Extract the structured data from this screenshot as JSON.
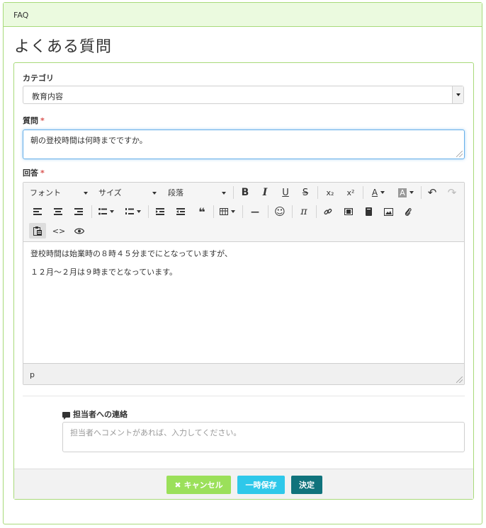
{
  "header": {
    "title": "FAQ"
  },
  "page_title": "よくある質問",
  "form": {
    "category": {
      "label": "カテゴリ",
      "value": "教育内容"
    },
    "question": {
      "label": "質問",
      "required_mark": "*",
      "value": "朝の登校時間は何時までですか。"
    },
    "answer": {
      "label": "回答",
      "required_mark": "*",
      "toolbar": {
        "font_label": "フォント",
        "size_label": "サイズ",
        "paragraph_label": "段落",
        "icons": [
          "bold-icon",
          "italic-icon",
          "underline-icon",
          "strikethrough-icon",
          "subscript-icon",
          "superscript-icon",
          "text-color-icon",
          "background-color-icon",
          "undo-icon",
          "redo-icon",
          "align-left-icon",
          "align-center-icon",
          "align-right-icon",
          "bullet-list-icon",
          "numbered-list-icon",
          "indent-icon",
          "outdent-icon",
          "blockquote-icon",
          "table-icon",
          "horizontal-rule-icon",
          "emoji-icon",
          "math-icon",
          "link-icon",
          "video-icon",
          "document-icon",
          "image-icon",
          "attachment-icon",
          "paste-text-icon",
          "source-code-icon",
          "preview-icon"
        ],
        "glyphs": {
          "bold": "B",
          "italic": "I",
          "underline": "U",
          "strike": "S",
          "sub": "x₂",
          "sup": "x²",
          "text_color": "A",
          "bg_color": "A",
          "undo": "↶",
          "redo": "↷",
          "quote": "❝",
          "hr": "—",
          "emoji": "☺",
          "pi": "π",
          "code": "<>",
          "link": "🔗"
        }
      },
      "content": [
        "登校時間は始業時の８時４５分までにとなっていますが、",
        "１２月〜２月は９時までとなっています。"
      ],
      "status_path": "p"
    },
    "contact": {
      "label": "担当者への連絡",
      "placeholder": "担当者へコメントがあれば、入力してください。"
    }
  },
  "buttons": {
    "cancel": "キャンセル",
    "cancel_icon": "✖",
    "temp_save": "一時保存",
    "confirm": "決定"
  },
  "colors": {
    "green_border": "#a8da7a",
    "header_bg": "#ebfadf",
    "cancel_bg": "#9be05a",
    "temp_bg": "#2ec8ea",
    "confirm_bg": "#10737c",
    "required": "#d9534f"
  }
}
